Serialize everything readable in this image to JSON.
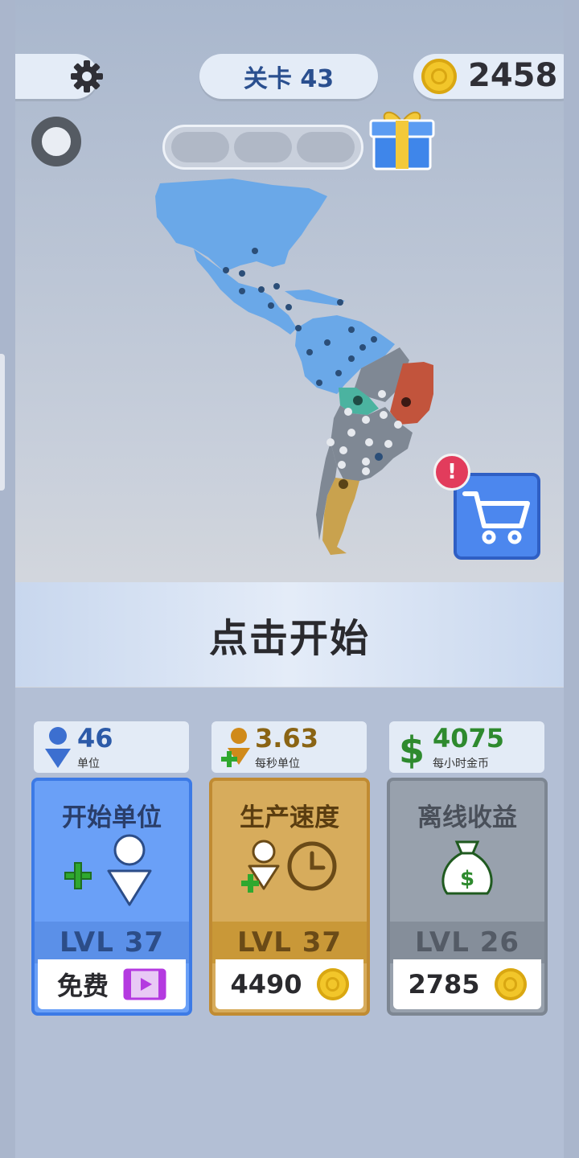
{
  "header": {
    "level_label": "关卡 43",
    "coin_balance": "2458"
  },
  "icons": {
    "settings": "gear-icon",
    "coin": "coin-icon",
    "gift": "gift-box-icon",
    "cart": "shopping-cart-icon",
    "ring": "ring-icon"
  },
  "progress": {
    "segments_total": 3,
    "segments_filled": 0
  },
  "shop": {
    "badge": "!"
  },
  "tap_to_start": "点击开始",
  "stats": [
    {
      "value": "46",
      "label": "单位"
    },
    {
      "value": "3.63",
      "label": "每秒单位"
    },
    {
      "value": "4075",
      "label": "每小时金币"
    }
  ],
  "upgrades": [
    {
      "title": "开始单位",
      "level": "LVL 37",
      "cost": "免费",
      "cost_icon": "video-ad-icon"
    },
    {
      "title": "生产速度",
      "level": "LVL 37",
      "cost": "4490",
      "cost_icon": "coin-icon"
    },
    {
      "title": "离线收益",
      "level": "LVL 26",
      "cost": "2785",
      "cost_icon": "coin-icon"
    }
  ],
  "colors": {
    "player_territory": "#6aa8e8",
    "neutral_territory": "#7f8894",
    "enemy_red": "#c2543c",
    "enemy_teal": "#4bb3a0",
    "enemy_gold": "#c9a24e",
    "stat_blue": "#2c5aa8",
    "stat_gold": "#8a6414",
    "stat_green": "#2e8a2e"
  }
}
